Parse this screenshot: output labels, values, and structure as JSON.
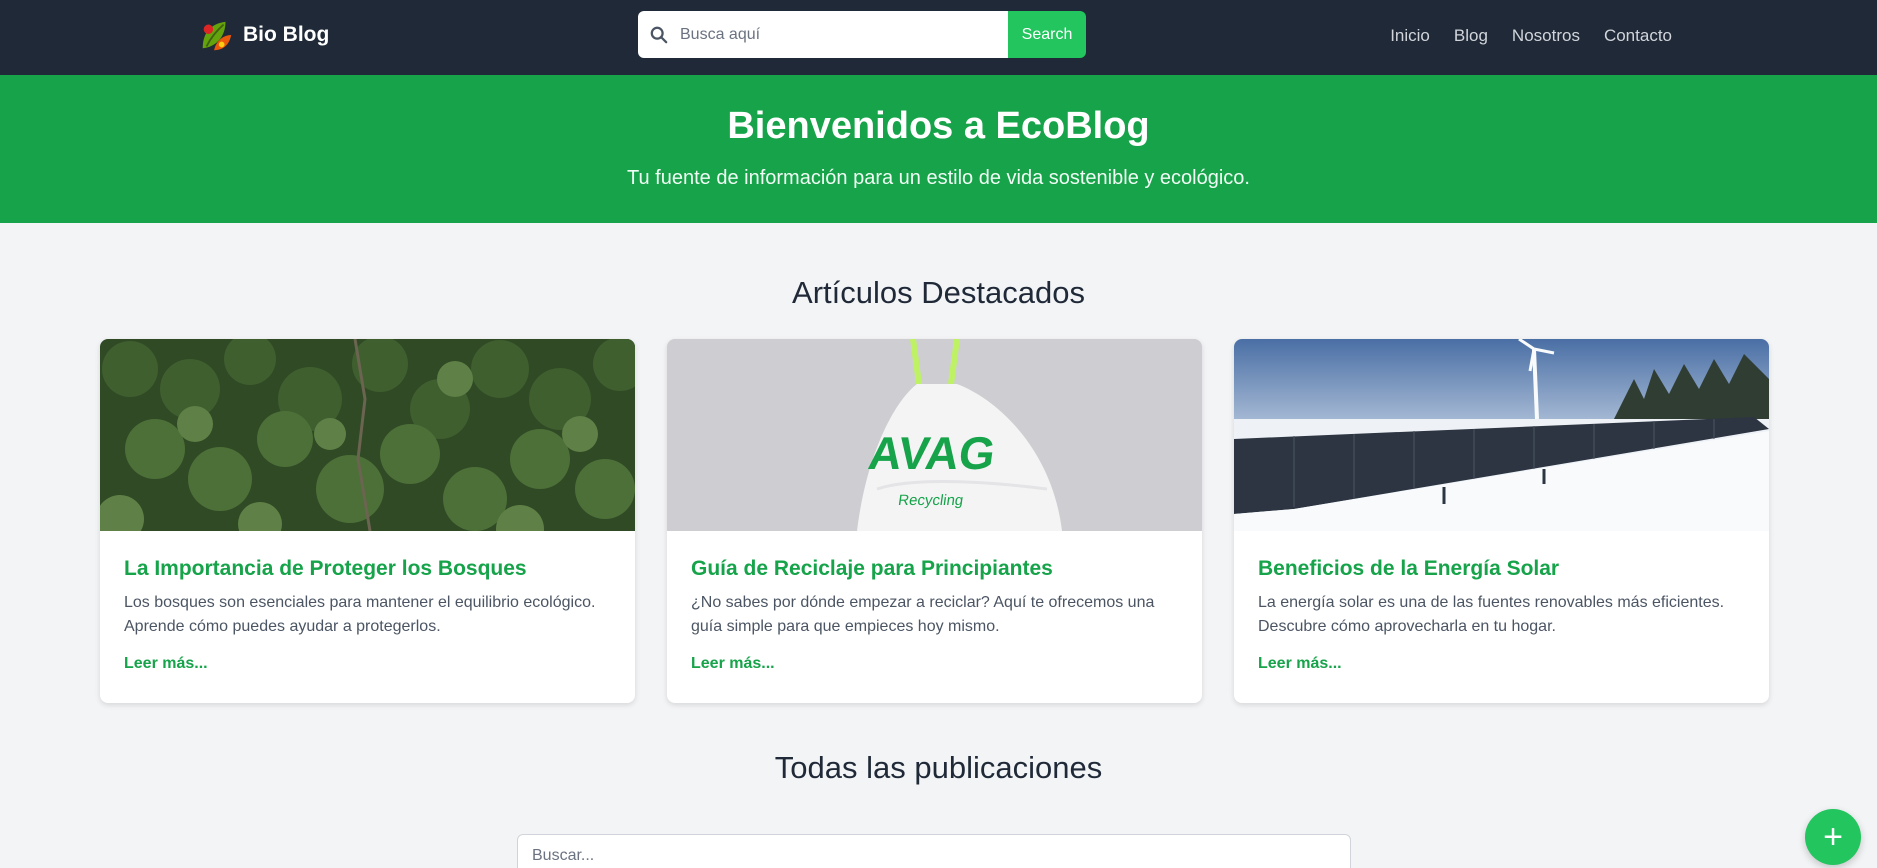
{
  "header": {
    "brand": "Bio Blog",
    "search_placeholder": "Busca aquí",
    "search_button": "Search",
    "nav": [
      {
        "label": "Inicio"
      },
      {
        "label": "Blog"
      },
      {
        "label": "Nosotros"
      },
      {
        "label": "Contacto"
      }
    ]
  },
  "hero": {
    "title": "Bienvenidos a EcoBlog",
    "subtitle": "Tu fuente de información para un estilo de vida sostenible y ecológico."
  },
  "featured": {
    "title": "Artículos Destacados",
    "cards": [
      {
        "title": "La Importancia de Proteger los Bosques",
        "text": "Los bosques son esenciales para mantener el equilibrio ecológico. Aprende cómo puedes ayudar a protegerlos.",
        "link": "Leer más...",
        "image": "forest-photo"
      },
      {
        "title": "Guía de Reciclaje para Principiantes",
        "text": "¿No sabes por dónde empezar a reciclar? Aquí te ofrecemos una guía simple para que empieces hoy mismo.",
        "link": "Leer más...",
        "image": "recycling-bag-photo",
        "image_text": "Recycling"
      },
      {
        "title": "Beneficios de la Energía Solar",
        "text": "La energía solar es una de las fuentes renovables más eficientes. Descubre cómo aprovecharla en tu hogar.",
        "link": "Leer más...",
        "image": "solar-panels-photo"
      }
    ]
  },
  "all_posts": {
    "title": "Todas las publicaciones",
    "search_placeholder": "Buscar..."
  },
  "fab": {
    "icon": "plus-icon",
    "label": "+"
  },
  "colors": {
    "navbar": "#1f2937",
    "green": "#16a34a",
    "accent": "#22c55e",
    "background": "#f3f4f6"
  }
}
